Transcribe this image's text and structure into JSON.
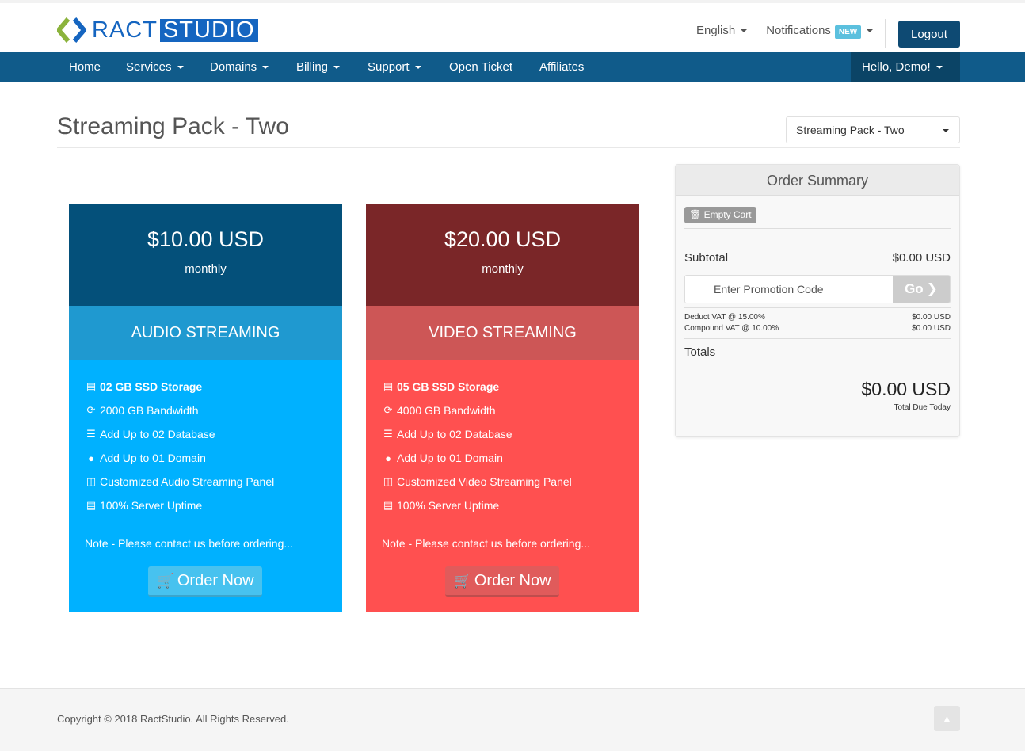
{
  "brand": {
    "logo_text": "RACT",
    "logo_box": "STUDIO"
  },
  "header": {
    "language": "English",
    "notifications": "Notifications",
    "notifications_badge": "NEW",
    "logout": "Logout"
  },
  "nav": {
    "items": [
      "Home",
      "Services",
      "Domains",
      "Billing",
      "Support",
      "Open Ticket",
      "Affiliates"
    ],
    "user": "Hello, Demo!"
  },
  "page": {
    "title": "Streaming Pack - Two",
    "product_select": "Streaming Pack - Two"
  },
  "plans": [
    {
      "price": "$10.00 USD",
      "cycle": "monthly",
      "name": "AUDIO STREAMING",
      "colors": {
        "top": "#04507a",
        "mid": "#1f99d0",
        "body": "#00b1ff",
        "button": "#47c2ef"
      },
      "features": [
        {
          "icon": "hdd-icon",
          "text": "02 GB SSD Storage"
        },
        {
          "icon": "refresh-icon",
          "text": "2000 GB Bandwidth"
        },
        {
          "icon": "database-icon",
          "text": "Add Up to 02 Database"
        },
        {
          "icon": "globe-icon",
          "text": "Add Up to 01 Domain"
        },
        {
          "icon": "columns-icon",
          "text": "Customized Audio Streaming Panel"
        },
        {
          "icon": "server-icon",
          "text": "100% Server Uptime"
        }
      ],
      "note": "Note - Please contact us before ordering...",
      "order_label": "Order Now"
    },
    {
      "price": "$20.00 USD",
      "cycle": "monthly",
      "name": "VIDEO STREAMING",
      "colors": {
        "top": "#7a2628",
        "mid": "#cd5656",
        "body": "#ff5050",
        "button": "#e05b5b"
      },
      "features": [
        {
          "icon": "hdd-icon",
          "text": "05 GB SSD Storage"
        },
        {
          "icon": "refresh-icon",
          "text": "4000 GB Bandwidth"
        },
        {
          "icon": "database-icon",
          "text": "Add Up to 02 Database"
        },
        {
          "icon": "globe-icon",
          "text": "Add Up to 01 Domain"
        },
        {
          "icon": "columns-icon",
          "text": "Customized Video Streaming Panel"
        },
        {
          "icon": "server-icon",
          "text": "100% Server Uptime"
        }
      ],
      "note": "Note - Please contact us before ordering...",
      "order_label": "Order Now"
    }
  ],
  "summary": {
    "title": "Order Summary",
    "empty_cart": "Empty Cart",
    "subtotal_label": "Subtotal",
    "subtotal_value": "$0.00 USD",
    "promo_placeholder": "Enter Promotion Code",
    "go_label": "Go",
    "taxes": [
      {
        "label": "Deduct VAT @ 15.00%",
        "value": "$0.00 USD"
      },
      {
        "label": "Compound VAT @ 10.00%",
        "value": "$0.00 USD"
      }
    ],
    "totals_label": "Totals",
    "total_value": "$0.00 USD",
    "total_caption": "Total Due Today"
  },
  "footer": {
    "copyright": "Copyright © 2018 RactStudio. All Rights Reserved."
  }
}
